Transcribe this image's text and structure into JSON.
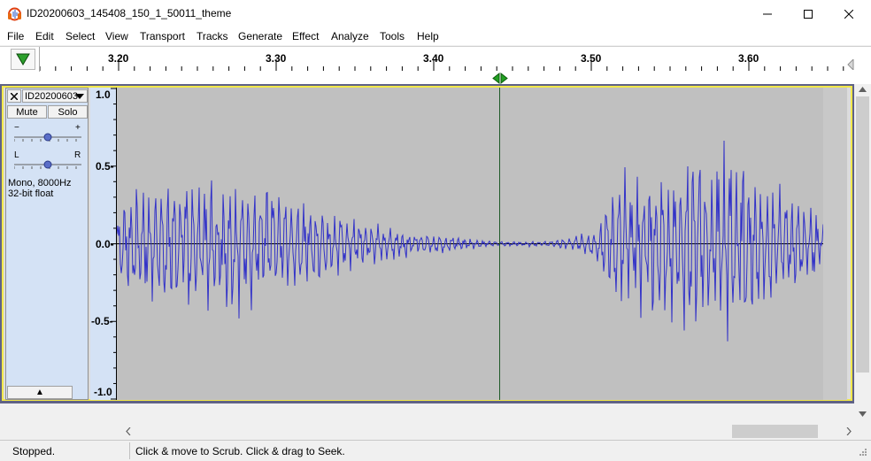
{
  "window": {
    "title": "ID20200603_145408_150_1_50011_theme",
    "icons": [
      "audacity-icon",
      "minimize-icon",
      "maximize-icon",
      "close-icon"
    ]
  },
  "menu": {
    "items": [
      "File",
      "Edit",
      "Select",
      "View",
      "Transport",
      "Tracks",
      "Generate",
      "Effect",
      "Analyze",
      "Tools",
      "Help"
    ]
  },
  "ruler": {
    "ticks": [
      "3.20",
      "3.30",
      "3.40",
      "3.50",
      "3.60"
    ]
  },
  "track": {
    "name": "ID20200603",
    "mute_label": "Mute",
    "solo_label": "Solo",
    "gain_minus": "−",
    "gain_plus": "+",
    "pan_left": "L",
    "pan_right": "R",
    "format_line1": "Mono, 8000Hz",
    "format_line2": "32-bit float",
    "collapse_glyph": "▲",
    "scale_labels": [
      "1.0",
      "0.5-",
      "0.0-",
      "-0.5-",
      "-1.0"
    ]
  },
  "colors": {
    "waveform": "#3232c8",
    "selection_bg": "#c0c0c0",
    "track_border": "#f2e84a",
    "track_info_bg": "#d4e2f5",
    "cursor_line": "#1e5a28",
    "ruler_marker": "#22a022"
  },
  "status": {
    "left": "Stopped.",
    "right": "Click & move to Scrub. Click & drag to Seek."
  }
}
